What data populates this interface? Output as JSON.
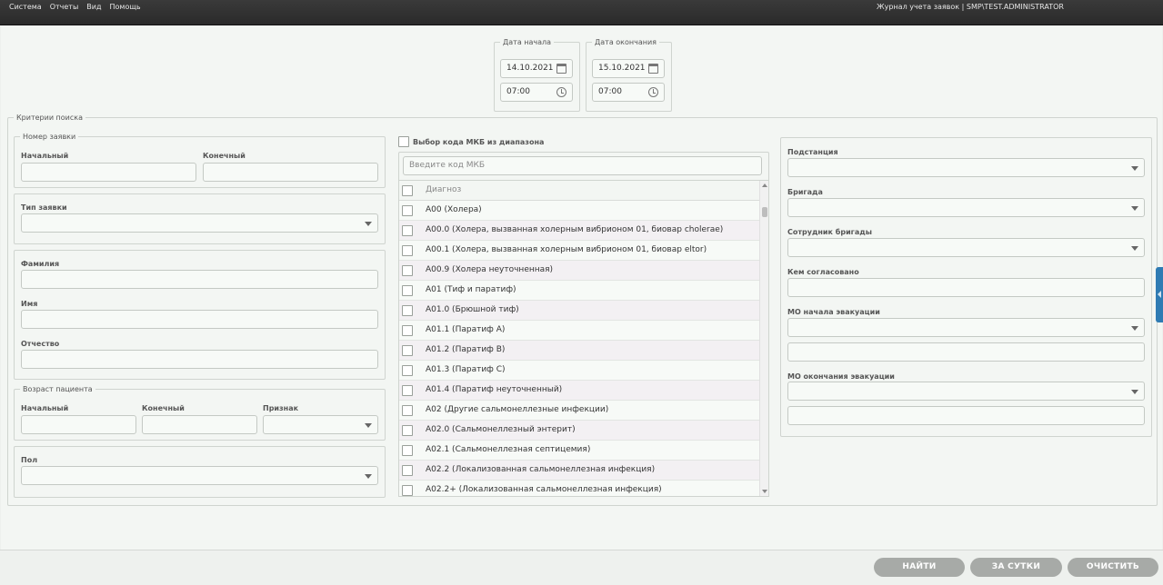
{
  "menu": {
    "items": [
      "Система",
      "Отчеты",
      "Вид",
      "Помощь"
    ],
    "title": "Журнал учета заявок | SMP\\TEST.ADMINISTRATOR"
  },
  "dates": {
    "start": {
      "legend": "Дата начала",
      "date": "14.10.2021",
      "time": "07:00"
    },
    "end": {
      "legend": "Дата окончания",
      "date": "15.10.2021",
      "time": "07:00"
    }
  },
  "criteria": {
    "legend": "Критерии поиска",
    "order_number": {
      "legend": "Номер заявки",
      "start_label": "Начальный",
      "end_label": "Конечный"
    },
    "order_type": {
      "label": "Тип заявки"
    },
    "lastname": {
      "label": "Фамилия"
    },
    "firstname": {
      "label": "Имя"
    },
    "patronymic": {
      "label": "Отчество"
    },
    "age": {
      "legend": "Возраст пациента",
      "start_label": "Начальный",
      "end_label": "Конечный",
      "sign_label": "Признак"
    },
    "sex": {
      "label": "Пол"
    }
  },
  "mkb": {
    "range_label": "Выбор кода МКБ из диапазона",
    "search_placeholder": "Введите код МКБ",
    "header": "Диагноз",
    "rows": [
      "A00 (Холера)",
      "A00.0 (Холера, вызванная холерным вибрионом 01, биовар cholerae)",
      "A00.1 (Холера, вызванная холерным вибрионом 01, биовар eltor)",
      "A00.9 (Холера неуточненная)",
      "A01 (Тиф и паратиф)",
      "A01.0 (Брюшной тиф)",
      "A01.1 (Паратиф A)",
      "A01.2 (Паратиф B)",
      "A01.3 (Паратиф C)",
      "A01.4 (Паратиф неуточненный)",
      "A02 (Другие сальмонеллезные инфекции)",
      "A02.0 (Сальмонеллезный энтерит)",
      "A02.1 (Сальмонеллезная септицемия)",
      "A02.2 (Локализованная сальмонеллезная инфекция)",
      "A02.2+ (Локализованная сальмонеллезная инфекция)"
    ]
  },
  "right": {
    "substation": "Подстанция",
    "brigade": "Бригада",
    "brigade_employee": "Сотрудник бригады",
    "approved_by": "Кем согласовано",
    "evac_start": "МО начала эвакуации",
    "evac_end": "МО окончания эвакуации"
  },
  "buttons": {
    "find": "НАЙТИ",
    "day": "ЗА СУТКИ",
    "clear": "ОЧИСТИТЬ"
  }
}
